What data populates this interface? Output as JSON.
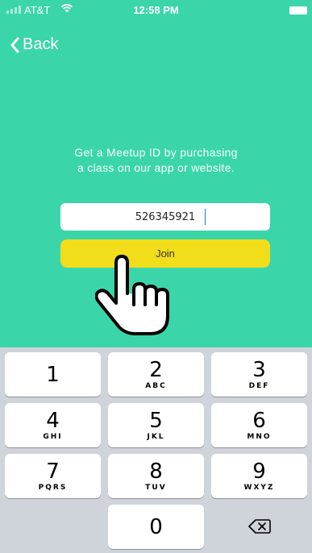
{
  "status_bar": {
    "carrier": "AT&T",
    "time": "12:58 PM"
  },
  "nav": {
    "back_label": "Back"
  },
  "info_lines": [
    "Get a Meetup ID by purchasing",
    "a class on our app or website."
  ],
  "meetup_input": {
    "value": "526345921"
  },
  "join_label": "Join",
  "keypad": {
    "keys": [
      {
        "num": "1",
        "letters": ""
      },
      {
        "num": "2",
        "letters": "ABC"
      },
      {
        "num": "3",
        "letters": "DEF"
      },
      {
        "num": "4",
        "letters": "GHI"
      },
      {
        "num": "5",
        "letters": "JKL"
      },
      {
        "num": "6",
        "letters": "MNO"
      },
      {
        "num": "7",
        "letters": "PQRS"
      },
      {
        "num": "8",
        "letters": "TUV"
      },
      {
        "num": "9",
        "letters": "WXYZ"
      },
      {
        "num": "0",
        "letters": ""
      }
    ]
  },
  "colors": {
    "background": "#3bd5aa",
    "join_button": "#f2dd1a",
    "keypad_bg": "#cfd3da"
  },
  "icons": {
    "back": "chevron-left-icon",
    "pointer": "hand-pointer-icon",
    "delete": "backspace-icon"
  }
}
